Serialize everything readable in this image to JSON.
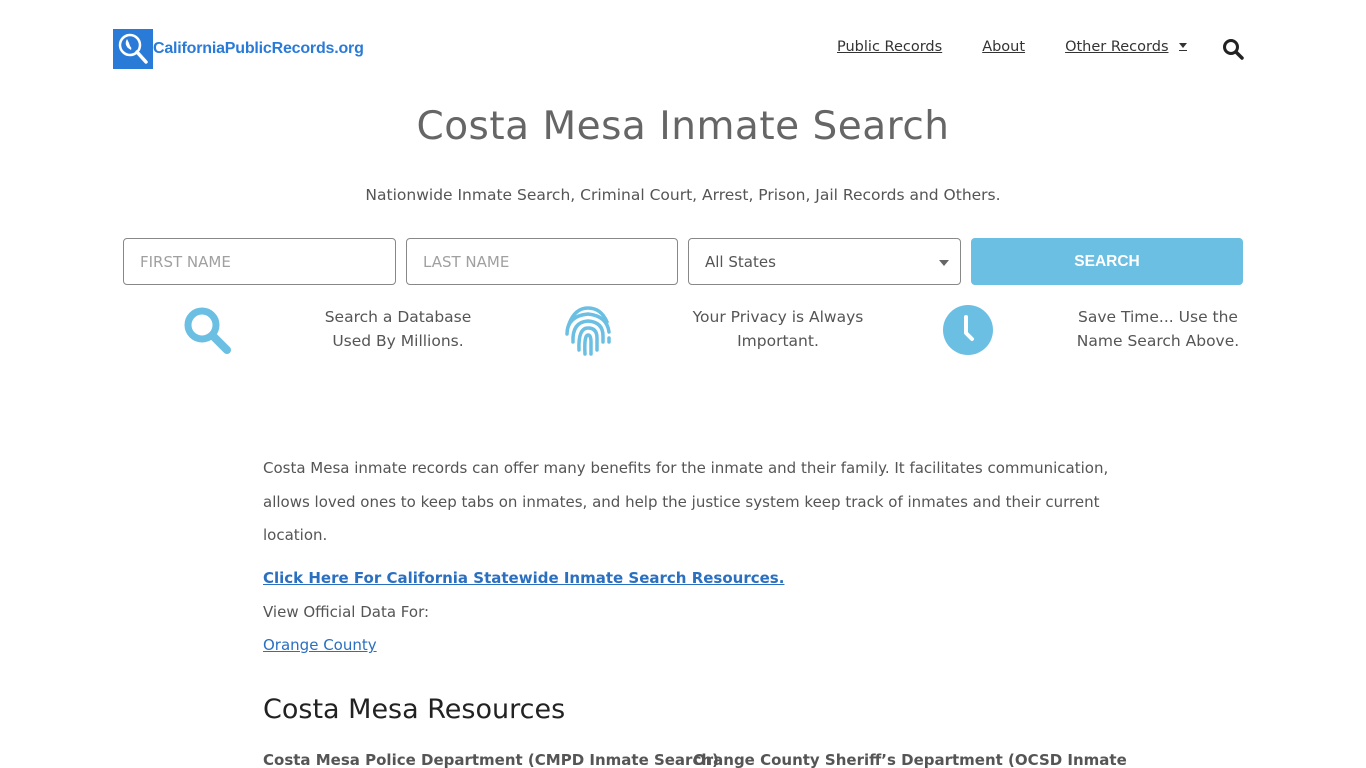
{
  "header": {
    "logo_text": "CaliforniaPublicRecords.org",
    "nav": [
      {
        "label": "Public Records"
      },
      {
        "label": "About"
      },
      {
        "label": "Other Records",
        "has_dropdown": true
      }
    ],
    "search_icon": "search-icon"
  },
  "main": {
    "title": "Costa Mesa Inmate Search",
    "subtitle": "Nationwide Inmate Search, Criminal Court, Arrest, Prison, Jail Records and Others.",
    "form": {
      "first_name_placeholder": "FIRST NAME",
      "last_name_placeholder": "LAST NAME",
      "state_selected": "All States",
      "search_label": "SEARCH"
    },
    "features": [
      {
        "icon": "magnifier-icon",
        "line1": "Search a Database",
        "line2": "Used By Millions."
      },
      {
        "icon": "fingerprint-icon",
        "line1": "Your Privacy is Always",
        "line2": "Important."
      },
      {
        "icon": "clock-icon",
        "line1": "Save Time... Use the",
        "line2": "Name Search Above."
      }
    ],
    "intro": "Costa Mesa inmate records can offer many benefits for the inmate and their family. It facilitates communication, allows loved ones to keep tabs on inmates, and help the justice system keep track of inmates and their current location.",
    "statewide_link": "Click Here For California Statewide Inmate Search Resources.",
    "view_official": "View Official Data For:",
    "county_link": "Orange County",
    "resources_heading": "Costa Mesa Resources",
    "resources": [
      "Costa Mesa Police Department (CMPD Inmate Search)",
      "Orange County Sheriff’s Department (OCSD Inmate"
    ]
  },
  "colors": {
    "brand_blue": "#2a7bd8",
    "accent_light_blue": "#6bbfe3",
    "link_blue": "#2a6fc0"
  }
}
